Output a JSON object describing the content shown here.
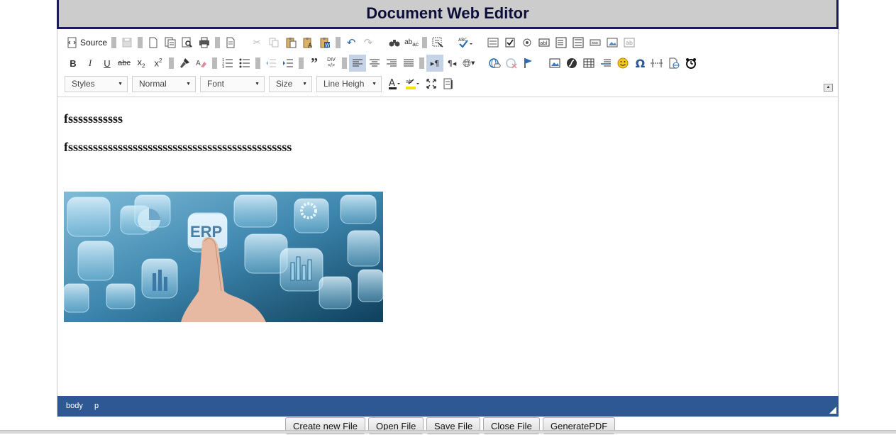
{
  "header": {
    "title": "Document Web Editor"
  },
  "toolbar": {
    "source_label": "Source",
    "combos": {
      "styles": "Styles",
      "format": "Normal",
      "font": "Font",
      "size": "Size",
      "line_height": "Line Heigh"
    },
    "row1_icons": [
      "source-icon",
      "save-icon",
      "new-page-icon",
      "templates-icon",
      "preview-icon",
      "print-icon",
      "document-icon",
      "cut-icon",
      "copy-icon",
      "paste-icon",
      "paste-text-icon",
      "paste-word-icon",
      "undo-icon",
      "redo-icon",
      "find-icon",
      "replace-icon",
      "select-all-icon",
      "spellcheck-icon",
      "form-icon",
      "checkbox-icon",
      "radio-icon",
      "textfield-icon",
      "textarea-icon",
      "select-icon",
      "button-icon",
      "image-button-icon",
      "hidden-field-icon"
    ],
    "row2_icons": [
      "bold-icon",
      "italic-icon",
      "underline-icon",
      "strikethrough-icon",
      "subscript-icon",
      "superscript-icon",
      "copy-format-icon",
      "remove-format-icon",
      "numbered-list-icon",
      "bulleted-list-icon",
      "outdent-icon",
      "indent-icon",
      "blockquote-icon",
      "div-icon",
      "align-left-icon",
      "align-center-icon",
      "align-right-icon",
      "justify-icon",
      "ltr-icon",
      "rtl-icon",
      "language-icon",
      "link-icon",
      "unlink-icon",
      "anchor-icon",
      "image-icon",
      "flash-icon",
      "table-icon",
      "horizontal-rule-icon",
      "smiley-icon",
      "special-char-icon",
      "page-break-icon",
      "iframe-icon",
      "clock-icon"
    ]
  },
  "content": {
    "paragraph1": "fsssssssssss",
    "paragraph2": "fsssssssssssssssssssssssssssssssssssssssssssss",
    "image_text": "ERP"
  },
  "statusbar": {
    "path": [
      "body",
      "p"
    ]
  },
  "footer_buttons": {
    "create": "Create new File",
    "open": "Open File",
    "save": "Save File",
    "close": "Close File",
    "generate": "GeneratePDF"
  },
  "colors": {
    "title_bg": "#cccccc",
    "title_border": "#1b1b5c",
    "statusbar_bg": "#2e5893",
    "active_button": "#c5d3e6"
  }
}
